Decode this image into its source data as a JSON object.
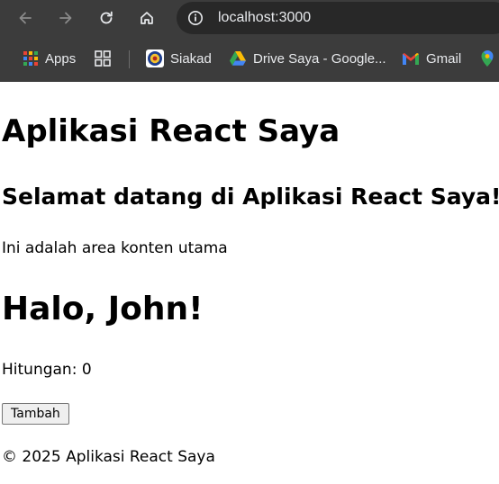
{
  "browser": {
    "url": "localhost:3000",
    "bookmarks": [
      {
        "label": "Apps"
      },
      {
        "label": "Siakad"
      },
      {
        "label": "Drive Saya - Google..."
      },
      {
        "label": "Gmail"
      }
    ],
    "colors": {
      "chrome_bg": "#3c3c3c",
      "omnibox_bg": "#282828",
      "text": "#e8eaed"
    }
  },
  "page": {
    "app_title": "Aplikasi React Saya",
    "welcome_heading": "Selamat datang di Aplikasi React Saya!",
    "content_text": "Ini adalah area konten utama",
    "greeting": "Halo, John!",
    "counter_label": "Hitungan: 0",
    "add_button_label": "Tambah",
    "footer": "© 2025 Aplikasi React Saya"
  }
}
